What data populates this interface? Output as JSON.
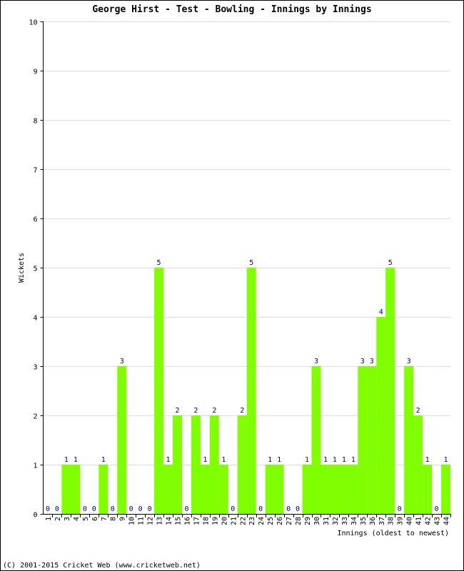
{
  "chart_data": {
    "type": "bar",
    "title": "George Hirst - Test - Bowling - Innings by Innings",
    "xlabel": "Innings (oldest to newest)",
    "ylabel": "Wickets",
    "ylim": [
      0,
      10
    ],
    "yticks": [
      0,
      1,
      2,
      3,
      4,
      5,
      6,
      7,
      8,
      9,
      10
    ],
    "grid": true,
    "categories": [
      "1",
      "2",
      "3",
      "4",
      "5",
      "6",
      "7",
      "8",
      "9",
      "10",
      "11",
      "12",
      "13",
      "14",
      "15",
      "16",
      "17",
      "18",
      "19",
      "20",
      "21",
      "22",
      "23",
      "24",
      "25",
      "26",
      "27",
      "28",
      "29",
      "30",
      "31",
      "32",
      "33",
      "34",
      "35",
      "36",
      "37",
      "38",
      "39",
      "40",
      "41",
      "42",
      "43",
      "44"
    ],
    "values": [
      0,
      0,
      1,
      1,
      0,
      0,
      1,
      0,
      3,
      0,
      0,
      0,
      5,
      1,
      2,
      0,
      2,
      1,
      2,
      1,
      0,
      2,
      5,
      0,
      1,
      1,
      0,
      0,
      1,
      3,
      1,
      1,
      1,
      1,
      3,
      3,
      4,
      5,
      0,
      3,
      2,
      1,
      0,
      1
    ],
    "bar_color": "#80ff00",
    "label_color": "#00008b"
  },
  "footer": "(C) 2001-2015 Cricket Web (www.cricketweb.net)"
}
